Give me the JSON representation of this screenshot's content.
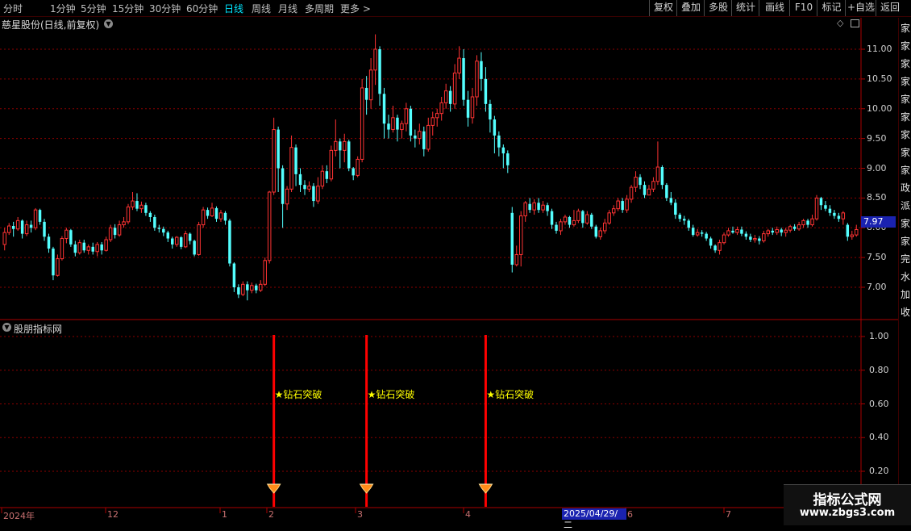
{
  "toolbar": {
    "periods": [
      "分时",
      "1分钟",
      "5分钟",
      "15分钟",
      "30分钟",
      "60分钟",
      "日线",
      "周线",
      "月线",
      "多周期",
      "更多"
    ],
    "active_period": "日线",
    "tools": [
      "复权",
      "叠加",
      "多股",
      "统计",
      "画线",
      "F10",
      "标记",
      "+自选",
      "返回"
    ]
  },
  "main": {
    "title": "慈星股份(日线,前复权)",
    "price_tag": "7.97",
    "y_ticks": [
      "11.00",
      "10.50",
      "10.00",
      "9.50",
      "9.00",
      "8.50",
      "8.00",
      "7.50",
      "7.00"
    ]
  },
  "sub": {
    "title": "股朋指标网",
    "y_ticks": [
      "1.00",
      "0.80",
      "0.60",
      "0.40",
      "0.20"
    ],
    "signal_label": "★钻石突破"
  },
  "dates": {
    "labels": [
      "2024年",
      "12",
      "1",
      "2",
      "3",
      "4",
      "6",
      "7"
    ],
    "highlight": "2025/04/29/二"
  },
  "side_strip": {
    "glyphs": [
      "家",
      "家",
      "家",
      "家",
      "家",
      "家",
      "家",
      "家",
      "家",
      "政",
      "派",
      "家",
      "家",
      "完",
      "水",
      "加",
      "收"
    ]
  },
  "watermark": {
    "line1": "指标公式网",
    "line2": "www.zbgs3.com"
  },
  "colors": {
    "up": "#ff3333",
    "down": "#54ffff",
    "grid": "#8b0000",
    "signal": "#ff0000",
    "label": "#ffff00"
  },
  "chart_data": {
    "type": "candlestick",
    "ylim": [
      6.65,
      11.3
    ],
    "candles": [
      [
        7.72,
        7.92,
        8.0,
        7.62
      ],
      [
        7.92,
        8.03,
        8.08,
        7.88
      ],
      [
        8.03,
        7.98,
        8.1,
        7.85
      ],
      [
        7.98,
        8.12,
        8.18,
        7.95
      ],
      [
        8.12,
        7.9,
        8.14,
        7.82
      ],
      [
        7.9,
        8.05,
        8.12,
        7.86
      ],
      [
        8.05,
        8.0,
        8.12,
        7.92
      ],
      [
        8.0,
        8.3,
        8.33,
        7.96
      ],
      [
        8.3,
        8.1,
        8.32,
        8.05
      ],
      [
        8.1,
        7.85,
        8.15,
        7.78
      ],
      [
        7.85,
        7.65,
        7.9,
        7.58
      ],
      [
        7.65,
        7.2,
        7.68,
        7.12
      ],
      [
        7.2,
        7.48,
        7.55,
        7.18
      ],
      [
        7.48,
        7.82,
        7.86,
        7.45
      ],
      [
        7.82,
        7.96,
        8.0,
        7.74
      ],
      [
        7.96,
        7.72,
        7.98,
        7.68
      ],
      [
        7.72,
        7.58,
        7.78,
        7.52
      ],
      [
        7.58,
        7.75,
        7.8,
        7.55
      ],
      [
        7.75,
        7.62,
        7.8,
        7.58
      ],
      [
        7.62,
        7.68,
        7.72,
        7.55
      ],
      [
        7.68,
        7.6,
        7.75,
        7.55
      ],
      [
        7.6,
        7.72,
        7.76,
        7.52
      ],
      [
        7.72,
        7.62,
        7.76,
        7.55
      ],
      [
        7.62,
        7.8,
        7.85,
        7.6
      ],
      [
        7.8,
        8.0,
        8.05,
        7.76
      ],
      [
        8.0,
        7.88,
        8.06,
        7.82
      ],
      [
        7.88,
        8.05,
        8.12,
        7.85
      ],
      [
        8.05,
        8.1,
        8.18,
        8.0
      ],
      [
        8.1,
        8.35,
        8.4,
        8.06
      ],
      [
        8.35,
        8.45,
        8.6,
        8.3
      ],
      [
        8.45,
        8.32,
        8.58,
        8.28
      ],
      [
        8.32,
        8.38,
        8.44,
        8.25
      ],
      [
        8.38,
        8.25,
        8.42,
        8.2
      ],
      [
        8.25,
        8.18,
        8.28,
        8.1
      ],
      [
        8.18,
        8.0,
        8.22,
        7.95
      ],
      [
        8.0,
        7.98,
        8.05,
        7.92
      ],
      [
        7.98,
        7.92,
        8.02,
        7.86
      ],
      [
        7.92,
        7.82,
        7.95,
        7.76
      ],
      [
        7.82,
        7.72,
        7.85,
        7.65
      ],
      [
        7.72,
        7.84,
        7.86,
        7.68
      ],
      [
        7.84,
        7.68,
        7.86,
        7.64
      ],
      [
        7.68,
        7.9,
        7.95,
        7.66
      ],
      [
        7.9,
        7.78,
        7.92,
        7.72
      ],
      [
        7.78,
        7.55,
        7.8,
        7.52
      ],
      [
        7.55,
        8.05,
        8.1,
        7.53
      ],
      [
        8.05,
        8.3,
        8.35,
        8.0
      ],
      [
        8.3,
        8.2,
        8.34,
        8.15
      ],
      [
        8.2,
        8.33,
        8.42,
        8.18
      ],
      [
        8.33,
        8.15,
        8.36,
        8.1
      ],
      [
        8.15,
        8.25,
        8.3,
        8.1
      ],
      [
        8.25,
        8.12,
        8.28,
        8.05
      ],
      [
        8.12,
        7.4,
        8.15,
        7.35
      ],
      [
        7.4,
        7.0,
        7.42,
        6.92
      ],
      [
        7.0,
        6.88,
        7.05,
        6.82
      ],
      [
        6.88,
        7.05,
        7.1,
        6.85
      ],
      [
        7.05,
        6.95,
        7.1,
        6.78
      ],
      [
        6.95,
        7.03,
        7.08,
        6.9
      ],
      [
        7.03,
        6.95,
        7.06,
        6.9
      ],
      [
        6.95,
        7.05,
        7.12,
        6.92
      ],
      [
        7.05,
        7.45,
        7.5,
        7.02
      ],
      [
        7.45,
        8.6,
        8.62,
        7.4
      ],
      [
        8.6,
        9.65,
        9.85,
        8.55
      ],
      [
        9.65,
        9.0,
        9.7,
        8.6
      ],
      [
        9.0,
        8.4,
        9.05,
        8.0
      ],
      [
        8.4,
        8.65,
        8.7,
        8.3
      ],
      [
        8.65,
        9.35,
        9.55,
        8.6
      ],
      [
        9.35,
        8.9,
        9.4,
        8.7
      ],
      [
        8.9,
        8.72,
        9.0,
        8.6
      ],
      [
        8.72,
        8.65,
        8.8,
        8.55
      ],
      [
        8.65,
        8.7,
        8.78,
        8.6
      ],
      [
        8.7,
        8.45,
        8.75,
        8.35
      ],
      [
        8.45,
        8.7,
        8.85,
        8.4
      ],
      [
        8.7,
        8.95,
        9.05,
        8.65
      ],
      [
        8.95,
        8.82,
        9.05,
        8.75
      ],
      [
        8.82,
        9.3,
        9.38,
        8.78
      ],
      [
        9.3,
        9.45,
        9.82,
        9.2
      ],
      [
        9.45,
        9.3,
        9.5,
        9.0
      ],
      [
        9.3,
        9.45,
        9.58,
        9.1
      ],
      [
        9.45,
        9.0,
        9.48,
        8.95
      ],
      [
        9.0,
        8.88,
        9.02,
        8.8
      ],
      [
        8.88,
        9.15,
        9.2,
        8.85
      ],
      [
        9.15,
        10.35,
        10.5,
        9.1
      ],
      [
        10.35,
        10.15,
        10.55,
        9.9
      ],
      [
        10.15,
        10.65,
        10.85,
        10.0
      ],
      [
        10.65,
        11.0,
        11.25,
        10.4
      ],
      [
        11.0,
        10.25,
        11.05,
        10.05
      ],
      [
        10.25,
        9.75,
        10.35,
        9.5
      ],
      [
        9.75,
        9.65,
        9.9,
        9.5
      ],
      [
        9.65,
        9.85,
        10.05,
        9.6
      ],
      [
        9.85,
        9.65,
        9.9,
        9.45
      ],
      [
        9.65,
        9.75,
        9.8,
        9.5
      ],
      [
        9.75,
        10.0,
        10.1,
        9.62
      ],
      [
        10.0,
        9.55,
        10.05,
        9.45
      ],
      [
        9.55,
        9.5,
        9.65,
        9.35
      ],
      [
        9.5,
        9.62,
        9.75,
        9.4
      ],
      [
        9.62,
        9.32,
        9.7,
        9.2
      ],
      [
        9.32,
        9.72,
        9.85,
        9.28
      ],
      [
        9.72,
        9.85,
        9.95,
        9.55
      ],
      [
        9.85,
        9.92,
        10.0,
        9.7
      ],
      [
        9.92,
        10.1,
        10.2,
        9.8
      ],
      [
        10.1,
        10.3,
        10.42,
        10.0
      ],
      [
        10.3,
        10.08,
        10.38,
        9.95
      ],
      [
        10.08,
        10.6,
        10.75,
        10.0
      ],
      [
        10.6,
        10.85,
        11.05,
        10.5
      ],
      [
        10.85,
        10.15,
        11.0,
        10.05
      ],
      [
        10.15,
        9.85,
        10.3,
        9.7
      ],
      [
        9.85,
        10.2,
        10.35,
        9.75
      ],
      [
        10.2,
        10.8,
        10.9,
        10.05
      ],
      [
        10.8,
        10.5,
        10.95,
        10.3
      ],
      [
        10.5,
        10.08,
        10.7,
        9.95
      ],
      [
        10.08,
        9.82,
        10.15,
        9.6
      ],
      [
        9.82,
        9.55,
        9.88,
        9.25
      ],
      [
        9.55,
        9.35,
        9.62,
        9.2
      ],
      [
        9.35,
        9.25,
        9.4,
        9.0
      ],
      [
        9.25,
        9.05,
        9.3,
        8.92
      ],
      [
        8.25,
        7.38,
        8.35,
        7.25
      ],
      [
        7.38,
        7.55,
        7.7,
        7.35
      ],
      [
        7.55,
        8.2,
        8.28,
        7.35
      ],
      [
        8.2,
        8.42,
        8.45,
        8.1
      ],
      [
        8.4,
        8.3,
        8.5,
        8.25
      ],
      [
        8.3,
        8.42,
        8.48,
        8.22
      ],
      [
        8.42,
        8.3,
        8.5,
        8.25
      ],
      [
        8.3,
        8.38,
        8.45,
        8.25
      ],
      [
        8.38,
        8.28,
        8.42,
        8.2
      ],
      [
        8.28,
        8.05,
        8.32,
        7.98
      ],
      [
        8.05,
        7.95,
        8.1,
        7.9
      ],
      [
        7.95,
        8.1,
        8.15,
        7.88
      ],
      [
        8.1,
        8.18,
        8.22,
        8.05
      ],
      [
        8.18,
        8.05,
        8.2,
        8.0
      ],
      [
        8.05,
        8.12,
        8.3,
        8.02
      ],
      [
        8.12,
        8.28,
        8.32,
        8.08
      ],
      [
        8.28,
        8.08,
        8.3,
        8.0
      ],
      [
        8.08,
        8.22,
        8.28,
        8.05
      ],
      [
        8.22,
        8.02,
        8.25,
        7.98
      ],
      [
        8.02,
        7.85,
        8.05,
        7.82
      ],
      [
        7.85,
        7.95,
        8.0,
        7.8
      ],
      [
        7.95,
        8.08,
        8.15,
        7.9
      ],
      [
        8.08,
        8.25,
        8.3,
        8.05
      ],
      [
        8.25,
        8.32,
        8.38,
        8.2
      ],
      [
        8.32,
        8.45,
        8.5,
        8.28
      ],
      [
        8.45,
        8.3,
        8.5,
        8.25
      ],
      [
        8.3,
        8.48,
        8.55,
        8.25
      ],
      [
        8.48,
        8.68,
        8.72,
        8.42
      ],
      [
        8.68,
        8.85,
        8.95,
        8.6
      ],
      [
        8.85,
        8.72,
        8.9,
        8.65
      ],
      [
        8.72,
        8.55,
        8.78,
        8.5
      ],
      [
        8.55,
        8.65,
        8.72,
        8.55
      ],
      [
        8.65,
        8.78,
        8.85,
        8.6
      ],
      [
        8.78,
        9.02,
        9.45,
        8.72
      ],
      [
        9.02,
        8.72,
        9.05,
        8.65
      ],
      [
        8.72,
        8.5,
        8.75,
        8.45
      ],
      [
        8.5,
        8.42,
        8.6,
        8.38
      ],
      [
        8.42,
        8.22,
        8.48,
        8.15
      ],
      [
        8.22,
        8.15,
        8.25,
        8.1
      ],
      [
        8.15,
        8.12,
        8.2,
        8.05
      ],
      [
        8.12,
        8.0,
        8.15,
        7.95
      ],
      [
        8.0,
        7.88,
        8.05,
        7.85
      ],
      [
        7.88,
        7.92,
        7.98,
        7.85
      ],
      [
        7.92,
        7.9,
        7.96,
        7.85
      ],
      [
        7.9,
        7.82,
        7.93,
        7.78
      ],
      [
        7.82,
        7.7,
        7.85,
        7.65
      ],
      [
        7.7,
        7.62,
        7.72,
        7.58
      ],
      [
        7.62,
        7.75,
        7.8,
        7.55
      ],
      [
        7.75,
        7.88,
        7.92,
        7.72
      ],
      [
        7.88,
        7.95,
        8.0,
        7.85
      ],
      [
        7.95,
        7.92,
        8.02,
        7.9
      ],
      [
        7.92,
        7.97,
        8.02,
        7.88
      ],
      [
        7.97,
        7.9,
        8.02,
        7.86
      ],
      [
        7.9,
        7.85,
        7.94,
        7.8
      ],
      [
        7.85,
        7.8,
        7.9,
        7.76
      ],
      [
        7.8,
        7.82,
        7.88,
        7.75
      ],
      [
        7.82,
        7.78,
        7.86,
        7.72
      ],
      [
        7.78,
        7.9,
        7.95,
        7.75
      ],
      [
        7.9,
        7.95,
        7.98,
        7.85
      ],
      [
        7.95,
        7.92,
        8.0,
        7.88
      ],
      [
        7.92,
        7.97,
        8.02,
        7.88
      ],
      [
        7.97,
        7.92,
        8.0,
        7.86
      ],
      [
        7.92,
        7.96,
        8.0,
        7.85
      ],
      [
        7.96,
        8.02,
        8.05,
        7.92
      ],
      [
        8.02,
        7.98,
        8.06,
        7.95
      ],
      [
        7.98,
        8.05,
        8.1,
        7.95
      ],
      [
        8.05,
        8.12,
        8.15,
        8.0
      ],
      [
        8.12,
        8.05,
        8.15,
        8.0
      ],
      [
        8.05,
        8.15,
        8.22,
        8.02
      ],
      [
        8.15,
        8.5,
        8.55,
        8.12
      ],
      [
        8.5,
        8.38,
        8.52,
        8.3
      ],
      [
        8.38,
        8.32,
        8.45,
        8.28
      ],
      [
        8.32,
        8.25,
        8.38,
        8.2
      ],
      [
        8.25,
        8.2,
        8.3,
        8.15
      ],
      [
        8.2,
        8.15,
        8.25,
        8.1
      ],
      [
        8.15,
        8.25,
        8.28,
        8.05
      ],
      [
        8.05,
        7.85,
        8.08,
        7.78
      ],
      [
        7.85,
        7.88,
        7.95,
        7.8
      ],
      [
        7.88,
        7.97,
        8.05,
        7.85
      ]
    ],
    "signal_days": [
      61,
      82,
      109
    ]
  }
}
